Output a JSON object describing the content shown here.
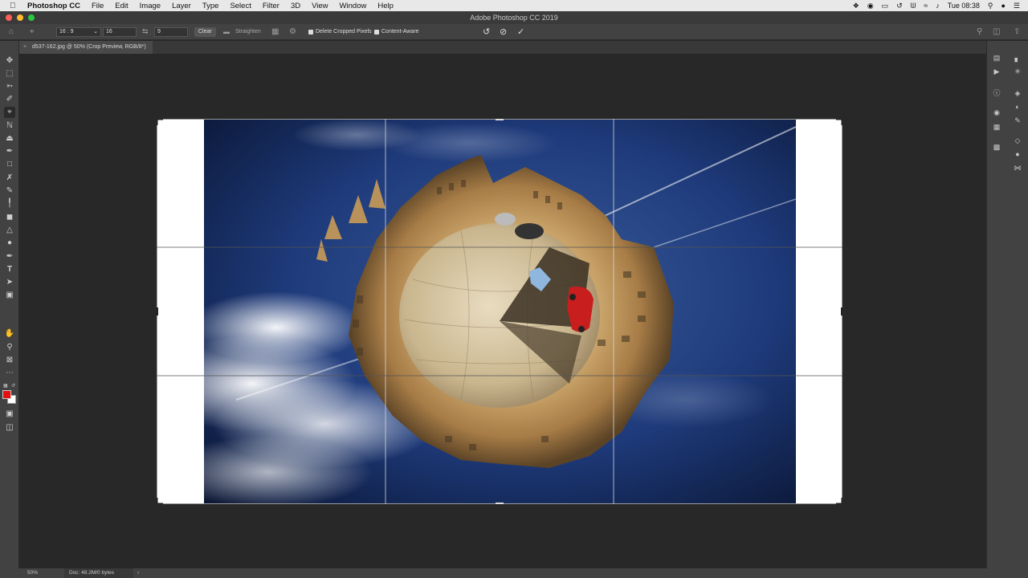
{
  "menubar": {
    "app_name": "Photoshop CC",
    "items": [
      "File",
      "Edit",
      "Image",
      "Layer",
      "Type",
      "Select",
      "Filter",
      "3D",
      "View",
      "Window",
      "Help"
    ],
    "clock": "Tue 08:38"
  },
  "window": {
    "title": "Adobe Photoshop CC 2019"
  },
  "options": {
    "ratio_preset": "16 : 9",
    "width_value": "16",
    "height_value": "9",
    "clear_label": "Clear",
    "straighten_label": "Straighten",
    "delete_cropped_label": "Delete Cropped Pixels",
    "delete_cropped_checked": true,
    "content_aware_label": "Content-Aware",
    "content_aware_checked": true
  },
  "document_tab": {
    "label": "d537-162.jpg @ 50% (Crop Preview, RGB/8*)"
  },
  "status": {
    "zoom": "50%",
    "doc_info": "Doc: 48.2M/0 bytes",
    "arrow": "›"
  },
  "colors": {
    "foreground": "#e8100f",
    "background": "#ffffff"
  },
  "tools": [
    "move",
    "marquee",
    "lasso",
    "quick-select",
    "crop",
    "eyedropper",
    "spot-healing",
    "brush",
    "clone-stamp",
    "history-brush",
    "eraser",
    "gradient",
    "blur",
    "dodge",
    "pen",
    "type",
    "path-select",
    "rectangle",
    "hand",
    "zoom",
    "more",
    "quick-mask",
    "screen-mode"
  ]
}
